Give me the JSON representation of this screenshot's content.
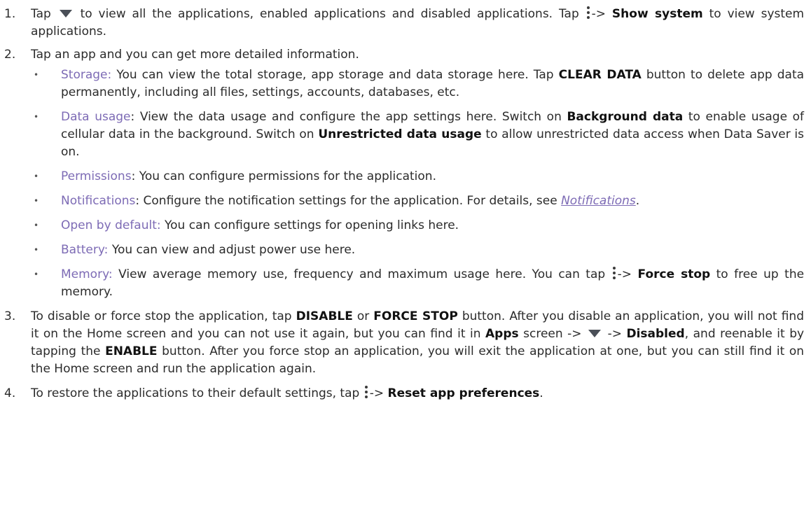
{
  "steps": [
    {
      "num": "1.",
      "t1": "Tap",
      "t2": "to view all the applications, enabled applications and disabled applications. Tap",
      "t3": "->",
      "b1": "Show system",
      "t4": "to view system applications."
    },
    {
      "num": "2.",
      "t1": "Tap an app and you can get more detailed information."
    },
    {
      "num": "3.",
      "t1": "To disable or force stop the application, tap",
      "b1": "DISABLE",
      "t2": "or",
      "b2": "FORCE STOP",
      "t3": "button. After you disable an application, you will not find it on the Home screen and you can not use it again, but you can find it in",
      "b3": "Apps",
      "t4": "screen ->",
      "t5": "->",
      "b4": "Disabled",
      "t6": ", and reenable it by tapping the",
      "b5": "ENABLE",
      "t7": "button. After you force stop an application, you will exit the application at one, but you can still find it on the Home screen and run the application again."
    },
    {
      "num": "4.",
      "t1": "To restore the applications to their default settings, tap",
      "t2": "->",
      "b1": "Reset app preferences",
      "t3": "."
    }
  ],
  "bullets": [
    {
      "term": "Storage:",
      "t1": "You can view the total storage, app storage and data storage here. Tap",
      "b1": "CLEAR DATA",
      "t2": "button to delete app data permanently, including all files, settings, accounts, databases, etc."
    },
    {
      "term": "Data usage",
      "t1": ": View the data usage and configure the app settings here. Switch on",
      "b1": "Background data",
      "t2": "to enable usage of cellular data in the  background. Switch on",
      "b2": "Unrestricted data usage",
      "t3": "to allow unrestricted data access when Data Saver is on."
    },
    {
      "term": "Permissions",
      "t1": ": You can configure permissions for the application."
    },
    {
      "term": "Notifications",
      "t1": ": Configure the notification settings for the application. For details, see",
      "link": "Notifications",
      "t2": "."
    },
    {
      "term": "Open by default:",
      "t1": "You can configure settings for opening links here."
    },
    {
      "term": "Battery:",
      "t1": "You can view and adjust power use here."
    },
    {
      "term": "Memory:",
      "t1": "View average memory use, frequency and maximum usage here. You can tap",
      "t2": "->",
      "b1": "Force stop",
      "t3": "to free up the memory."
    }
  ],
  "bullet_glyph": "•",
  "icons": {
    "dropdown": "dropdown-triangle-icon",
    "menu": "more-vert-icon"
  },
  "colors": {
    "term": "#7d6bb5",
    "text": "#2b2b2b"
  }
}
